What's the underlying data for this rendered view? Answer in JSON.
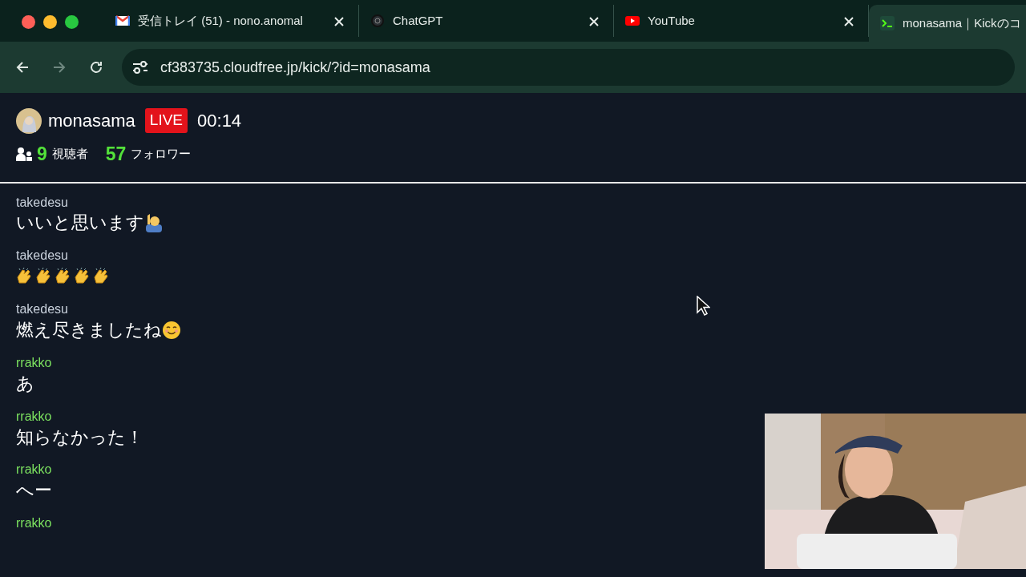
{
  "browser": {
    "tabs": [
      {
        "title": "受信トレイ (51) - nono.anomal",
        "kind": "mail",
        "selected": false
      },
      {
        "title": "ChatGPT",
        "kind": "chat",
        "selected": false
      },
      {
        "title": "YouTube",
        "kind": "video",
        "selected": false
      },
      {
        "title": "monasama｜Kickのコ",
        "kind": "terminal",
        "selected": true
      }
    ],
    "url": "cf383735.cloudfree.jp/kick/?id=monasama"
  },
  "stream": {
    "channel": "monasama",
    "live_badge": "LIVE",
    "elapsed": "00:14",
    "viewers": "9",
    "viewers_label": "視聴者",
    "followers": "57",
    "followers_label": "フォロワー"
  },
  "chat": [
    {
      "user": "takedesu",
      "color": "#c9d1dc",
      "text": "いいと思います",
      "emoji": [
        {
          "kind": "raised-hand"
        }
      ]
    },
    {
      "user": "takedesu",
      "color": "#c9d1dc",
      "emoji": [
        {
          "kind": "clap"
        },
        {
          "kind": "clap"
        },
        {
          "kind": "clap"
        },
        {
          "kind": "clap"
        },
        {
          "kind": "clap"
        }
      ]
    },
    {
      "user": "takedesu",
      "color": "#c9d1dc",
      "text": "燃え尽きましたね",
      "emoji": [
        {
          "kind": "smile"
        }
      ]
    },
    {
      "user": "rrakko",
      "color": "#7be05f",
      "text": "あ"
    },
    {
      "user": "rrakko",
      "color": "#7be05f",
      "text": "知らなかった！"
    },
    {
      "user": "rrakko",
      "color": "#7be05f",
      "text": "へー"
    },
    {
      "user": "rrakko",
      "color": "#7be05f"
    }
  ]
}
